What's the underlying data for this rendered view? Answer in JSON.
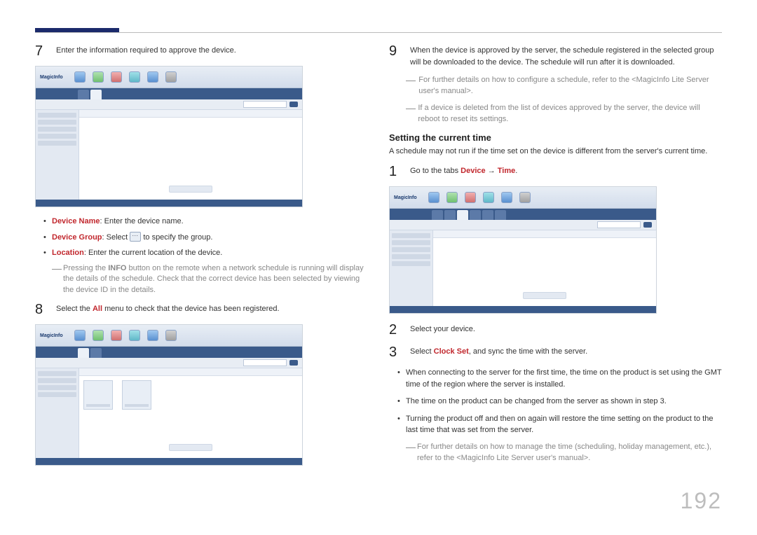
{
  "page_number": "192",
  "screenshot_app": "MagicInfo",
  "left": {
    "step7": {
      "num": "7",
      "text": "Enter the information required to approve the device."
    },
    "bullet_device_name_key": "Device Name",
    "bullet_device_name_text": ": Enter the device name.",
    "bullet_device_group_key": "Device Group",
    "bullet_device_group_text_a": ": Select ",
    "bullet_device_group_text_b": " to specify the group.",
    "bullet_location_key": "Location",
    "bullet_location_text": ": Enter the current location of the device.",
    "note_info_a": "Pressing the ",
    "note_info_b": "INFO",
    "note_info_c": " button on the remote when a network schedule is running will display the details of the schedule. Check that the correct device has been selected by viewing the device ID in the details.",
    "step8": {
      "num": "8",
      "text_a": "Select the ",
      "text_b": "All",
      "text_c": " menu to check that the device has been registered."
    }
  },
  "right": {
    "step9": {
      "num": "9",
      "text": "When the device is approved by the server, the schedule registered in the selected group will be downloaded to the device. The schedule will run after it is downloaded."
    },
    "note1": "For further details on how to configure a schedule, refer to the <MagicInfo Lite Server user's manual>.",
    "note2": "If a device is deleted from the list of devices approved by the server, the device will reboot to reset its settings.",
    "section_title": "Setting the current time",
    "lead": "A schedule may not run if the time set on the device is different from the server's current time.",
    "step1": {
      "num": "1",
      "text_a": "Go to the tabs ",
      "text_b": "Device",
      "text_arrow": " → ",
      "text_c": "Time",
      "text_d": "."
    },
    "step2": {
      "num": "2",
      "text": "Select your device."
    },
    "step3": {
      "num": "3",
      "text_a": "Select ",
      "text_b": "Clock Set",
      "text_c": ", and sync the time with the server."
    },
    "sub1": "When connecting to the server for the first time, the time on the product is set using the GMT time of the region where the server is installed.",
    "sub2": "The time on the product can be changed from the server as shown in step 3.",
    "sub3": "Turning the product off and then on again will restore the time setting on the product to the last time that was set from the server.",
    "note3": "For further details on how to manage the time (scheduling, holiday management, etc.), refer to the <MagicInfo Lite Server user's manual>."
  }
}
